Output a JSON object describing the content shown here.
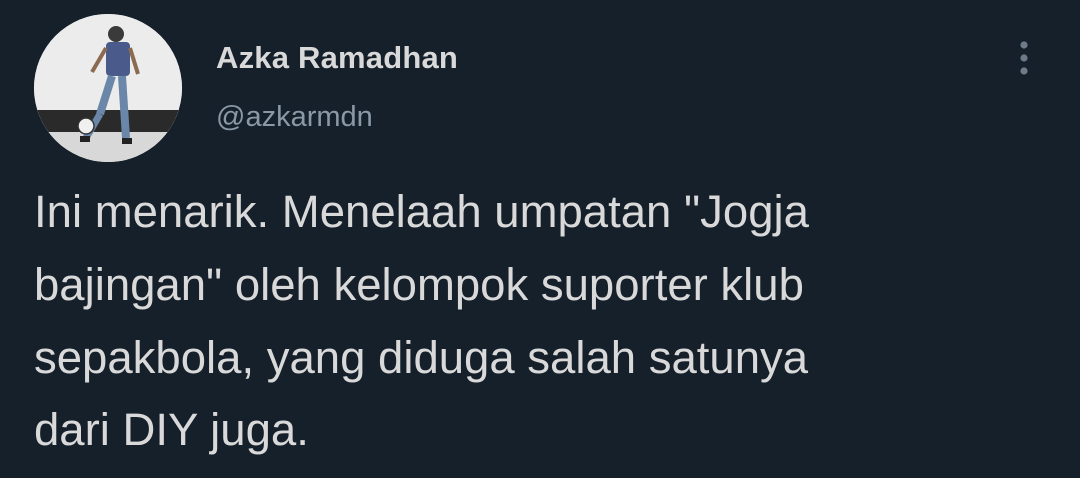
{
  "tweet": {
    "author": {
      "display_name": "Azka Ramadhan",
      "handle": "@azkarmdn"
    },
    "text": "Ini menarik. Menelaah umpatan \"Jogja\nbajingan\" oleh kelompok suporter klub\nsepakbola, yang diduga salah satunya\ndari DIY juga."
  },
  "icons": {
    "more": "more-vertical-icon"
  },
  "colors": {
    "background": "#15202b",
    "text_primary": "#d9d9d9",
    "text_secondary": "#8b98a5"
  }
}
